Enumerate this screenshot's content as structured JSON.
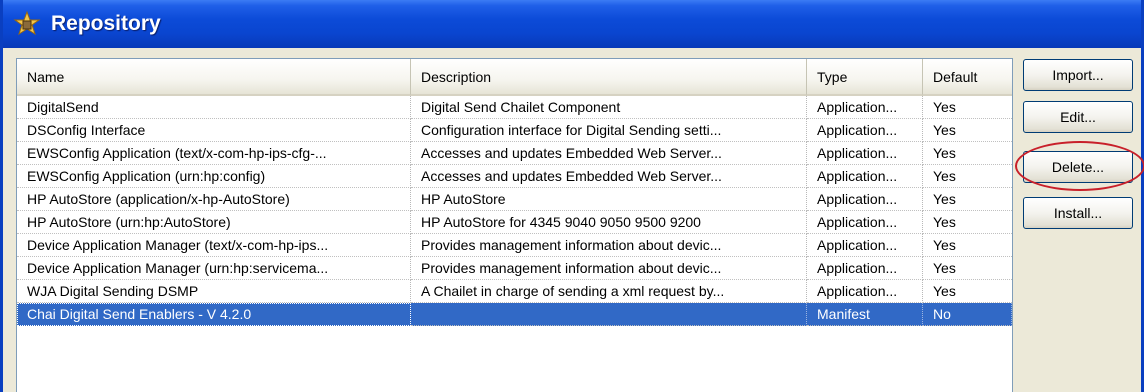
{
  "window": {
    "title": "Repository",
    "icon": "repository-icon"
  },
  "columns": [
    "Name",
    "Description",
    "Type",
    "Default"
  ],
  "rows": [
    [
      "DigitalSend",
      "Digital Send Chailet Component",
      "Application...",
      "Yes"
    ],
    [
      "DSConfig Interface",
      "Configuration interface for Digital Sending setti...",
      "Application...",
      "Yes"
    ],
    [
      "EWSConfig Application (text/x-com-hp-ips-cfg-...",
      "Accesses and updates Embedded Web Server...",
      "Application...",
      "Yes"
    ],
    [
      "EWSConfig Application (urn:hp:config)",
      "Accesses and updates Embedded Web Server...",
      "Application...",
      "Yes"
    ],
    [
      "HP AutoStore (application/x-hp-AutoStore)",
      "HP AutoStore",
      "Application...",
      "Yes"
    ],
    [
      "HP AutoStore (urn:hp:AutoStore)",
      "HP AutoStore for 4345 9040 9050 9500 9200",
      "Application...",
      "Yes"
    ],
    [
      "Device Application Manager (text/x-com-hp-ips...",
      "Provides management information about devic...",
      "Application...",
      "Yes"
    ],
    [
      "Device Application Manager (urn:hp:servicema...",
      "Provides management information about devic...",
      "Application...",
      "Yes"
    ],
    [
      "WJA Digital Sending DSMP",
      "A Chailet in charge of sending a xml request by...",
      "Application...",
      "Yes"
    ],
    [
      "Chai Digital Send Enablers - V 4.2.0",
      "",
      "Manifest",
      "No"
    ]
  ],
  "selected_row": 9,
  "buttons": {
    "import": "Import...",
    "edit": "Edit...",
    "delete": "Delete...",
    "install": "Install..."
  },
  "annotation": {
    "highlight": "delete-button",
    "color": "#c8202a"
  },
  "colors": {
    "titlebar": "#0a45cf",
    "selection": "#3169c6"
  }
}
